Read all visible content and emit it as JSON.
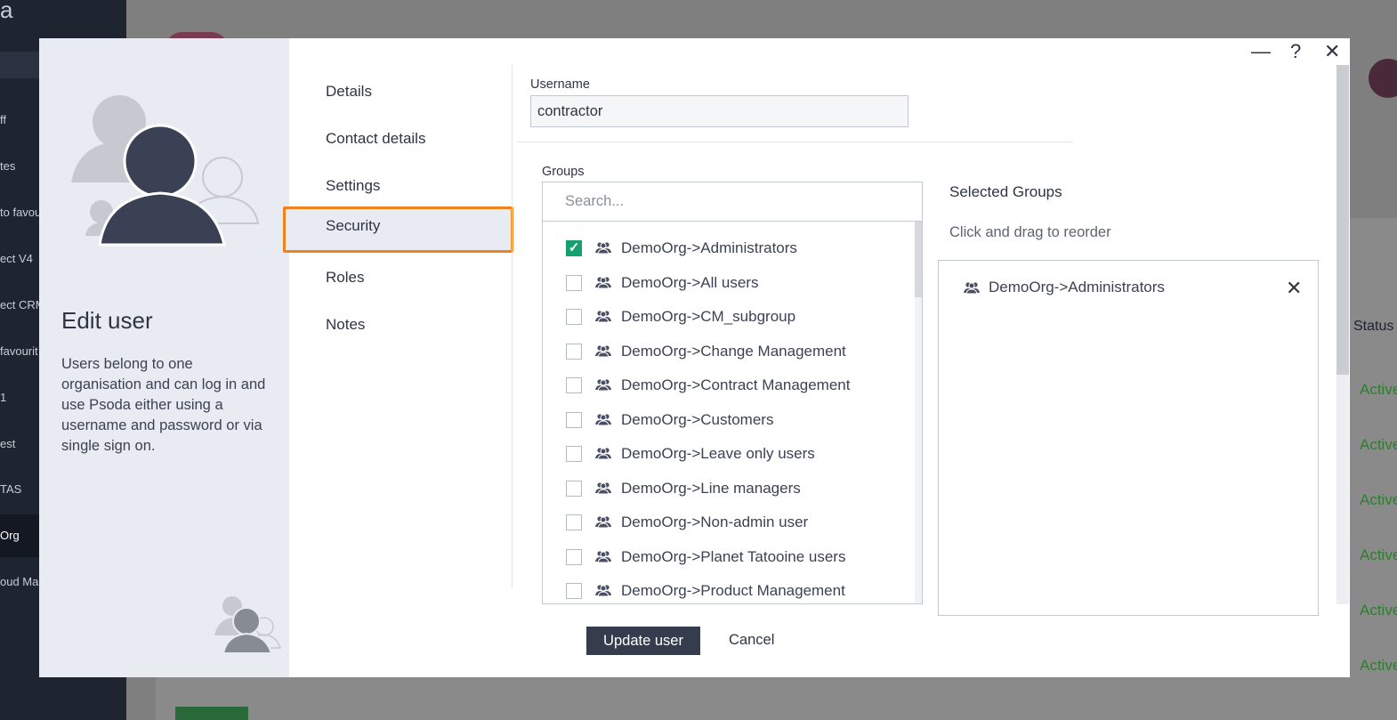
{
  "background": {
    "logo": "a",
    "sidebar_items": [
      "ff",
      "tes",
      "to favou",
      "ect V4",
      "ect CRM",
      "favourit",
      "1",
      "est",
      "TAS",
      "Org",
      "oud Man"
    ],
    "status_header": "Status",
    "active_labels": [
      "Active",
      "Active",
      "Active",
      "Active",
      "Active",
      "Active"
    ]
  },
  "window": {
    "minimize": "—",
    "help": "?",
    "close": "✕"
  },
  "left_panel": {
    "title": "Edit user",
    "description": "Users belong to one organisation and can log in and use Psoda either using a username and password or via single sign on."
  },
  "nav": {
    "items": [
      "Details",
      "Contact details",
      "Settings",
      "Security",
      "Roles",
      "Notes"
    ],
    "active": "Security"
  },
  "form": {
    "username_label": "Username",
    "username_value": "contractor",
    "groups_label": "Groups",
    "search_placeholder": "Search..."
  },
  "groups": [
    {
      "label": "DemoOrg->Administrators",
      "checked": true
    },
    {
      "label": "DemoOrg->All users",
      "checked": false
    },
    {
      "label": "DemoOrg->CM_subgroup",
      "checked": false
    },
    {
      "label": "DemoOrg->Change Management",
      "checked": false
    },
    {
      "label": "DemoOrg->Contract Management",
      "checked": false
    },
    {
      "label": "DemoOrg->Customers",
      "checked": false
    },
    {
      "label": "DemoOrg->Leave only users",
      "checked": false
    },
    {
      "label": "DemoOrg->Line managers",
      "checked": false
    },
    {
      "label": "DemoOrg->Non-admin user",
      "checked": false
    },
    {
      "label": "DemoOrg->Planet Tatooine users",
      "checked": false
    },
    {
      "label": "DemoOrg->Product Management",
      "checked": false
    }
  ],
  "selected": {
    "title": "Selected Groups",
    "hint": "Click and drag to reorder",
    "items": [
      "DemoOrg->Administrators"
    ]
  },
  "buttons": {
    "update": "Update user",
    "cancel": "Cancel"
  },
  "colors": {
    "highlight": "#f0821e",
    "check": "#16a06d",
    "primary_button": "#353c4d"
  }
}
